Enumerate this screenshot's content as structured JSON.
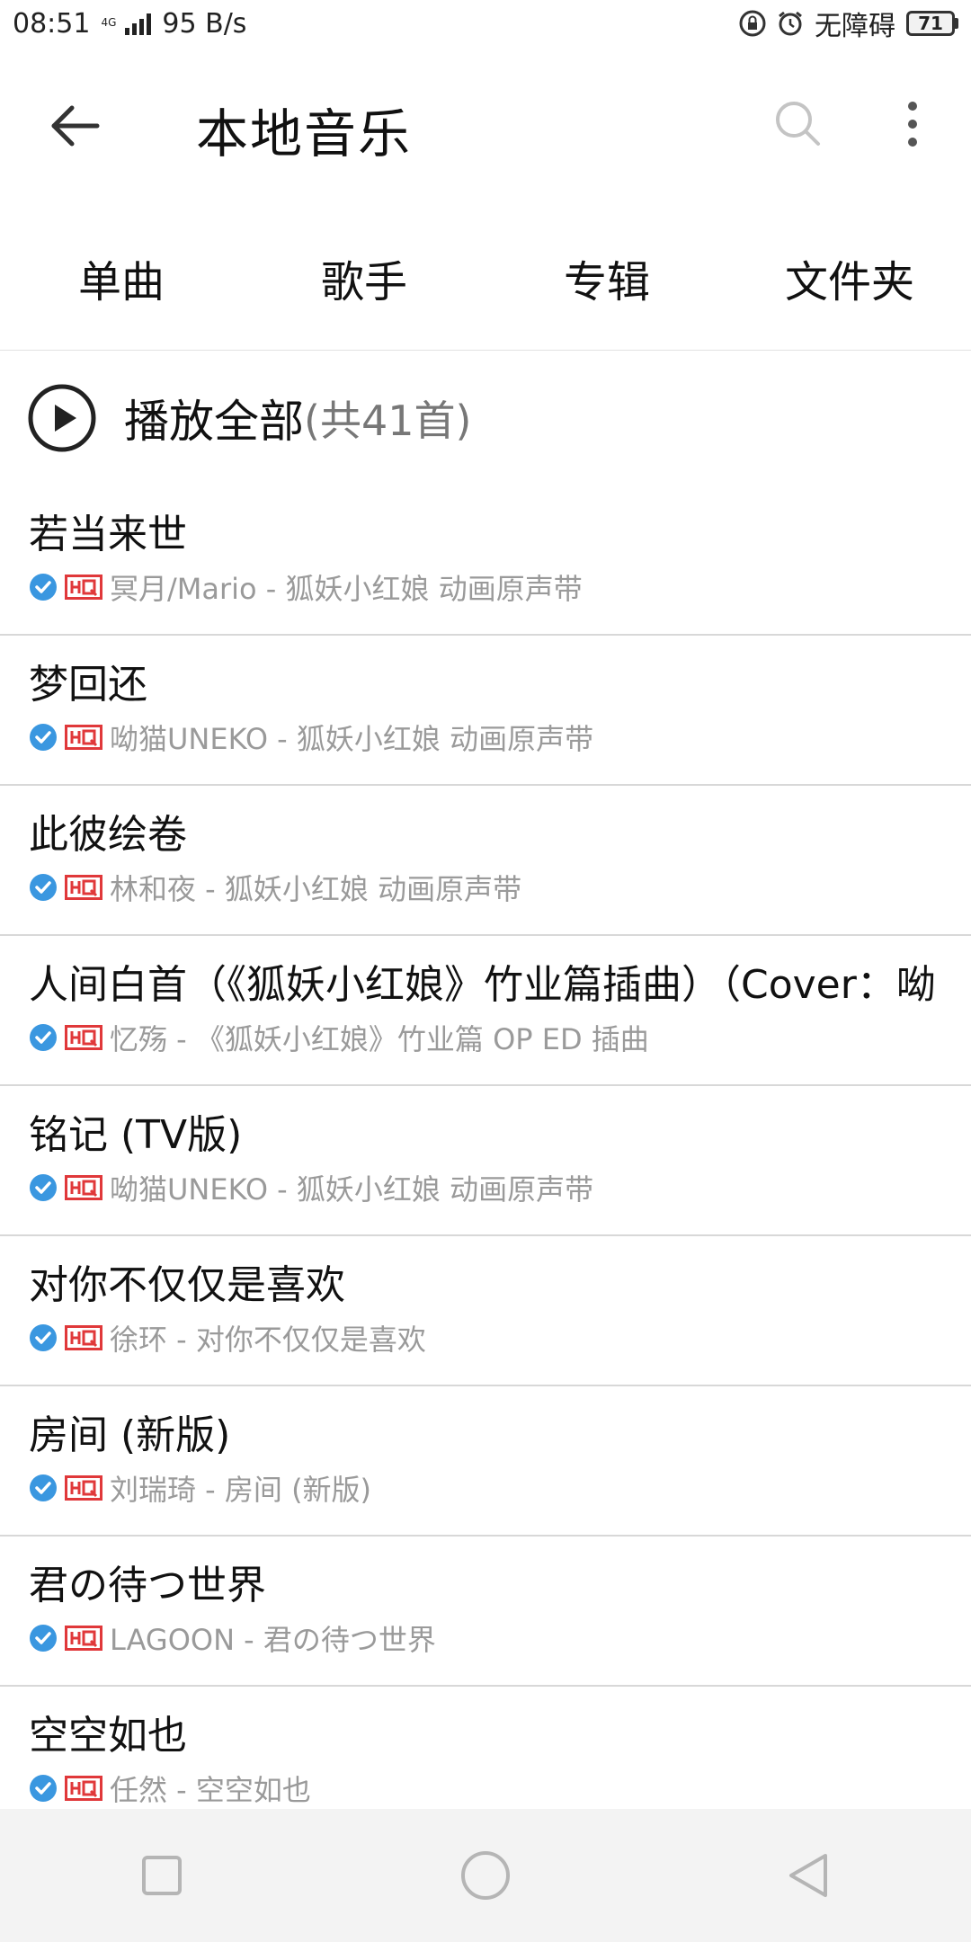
{
  "status_bar": {
    "time": "08:51",
    "network_tag": "4G",
    "speed": "95 B/s",
    "accessibility_label": "无障碍",
    "battery": "71"
  },
  "header": {
    "title": "本地音乐"
  },
  "tabs": [
    {
      "label": "单曲"
    },
    {
      "label": "歌手"
    },
    {
      "label": "专辑"
    },
    {
      "label": "文件夹"
    }
  ],
  "play_all": {
    "label": "播放全部",
    "count": "(共41首)"
  },
  "songs": [
    {
      "title": "若当来世",
      "artist_album": "冥月/Mario - 狐妖小红娘 动画原声带"
    },
    {
      "title": "梦回还",
      "artist_album": "呦猫UNEKO - 狐妖小红娘 动画原声带"
    },
    {
      "title": "此彼绘卷",
      "artist_album": "林和夜 - 狐妖小红娘 动画原声带"
    },
    {
      "title": "人间白首（《狐妖小红娘》竹业篇插曲）（Cover：呦",
      "artist_album": "忆殇 - 《狐妖小红娘》竹业篇 OP ED 插曲"
    },
    {
      "title": "铭记 (TV版)",
      "artist_album": "呦猫UNEKO - 狐妖小红娘 动画原声带"
    },
    {
      "title": "对你不仅仅是喜欢",
      "artist_album": "徐环 - 对你不仅仅是喜欢"
    },
    {
      "title": "房间 (新版)",
      "artist_album": "刘瑞琦 - 房间 (新版)"
    },
    {
      "title": "君の待つ世界",
      "artist_album": "LAGOON - 君の待つ世界"
    },
    {
      "title": "空空如也",
      "artist_album": "任然 - 空空如也"
    }
  ],
  "colors": {
    "check_blue": "#3a97e0",
    "hq_red": "#e0383a",
    "meta_gray": "#9a9a9a"
  }
}
